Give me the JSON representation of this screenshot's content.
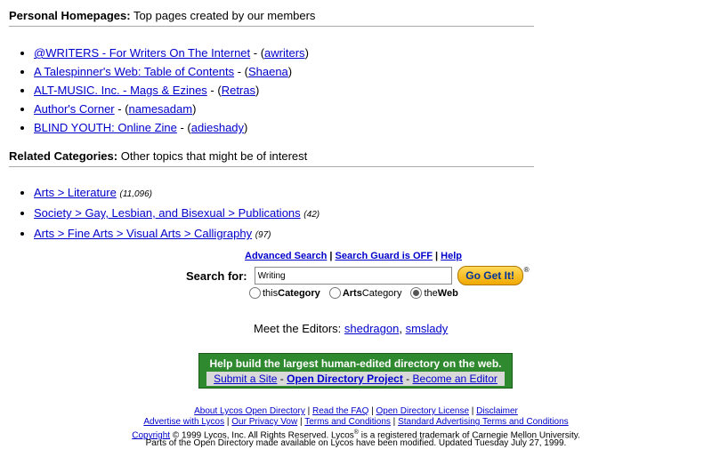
{
  "personal": {
    "heading": "Personal Homepages:",
    "subheading": "Top pages created by our members",
    "items": [
      {
        "title": "@WRITERS - For Writers On The Internet",
        "user": "awriters"
      },
      {
        "title": "A Talespinner's Web: Table of Contents",
        "user": "Shaena"
      },
      {
        "title": "ALT-MUSIC. Inc. - Mags & Ezines",
        "user": "Retras"
      },
      {
        "title": "Author's Corner",
        "user": "namesadam"
      },
      {
        "title": "BLIND YOUTH: Online Zine",
        "user": "adieshady"
      }
    ]
  },
  "related": {
    "heading": "Related Categories:",
    "subheading": "Other topics that might be of interest",
    "items": [
      {
        "path": "Arts > Literature",
        "count": "(11,096)"
      },
      {
        "path": "Society > Gay, Lesbian, and Bisexual > Publications",
        "count": "(42)"
      },
      {
        "path": "Arts > Fine Arts > Visual Arts > Calligraphy",
        "count": "(97)"
      }
    ]
  },
  "search": {
    "links": [
      "Advanced Search",
      "Search Guard is OFF",
      "Help"
    ],
    "label": "Search for:",
    "value": "Writing",
    "button": "Go Get It!",
    "reg_mark": "®",
    "options": [
      {
        "label_prefix": "this ",
        "label_bold": "Category",
        "checked": false
      },
      {
        "label_prefix": "",
        "label_bold": "Arts",
        "label_suffix": " Category",
        "checked": false
      },
      {
        "label_prefix": "the ",
        "label_bold": "Web",
        "checked": true
      }
    ]
  },
  "editors": {
    "label": "Meet the Editors:",
    "names": [
      "shedragon",
      "smslady"
    ]
  },
  "help_box": {
    "title": "Help build the largest human-edited directory on the web.",
    "links": [
      "Submit a Site",
      "Open Directory Project",
      "Become an Editor"
    ]
  },
  "footer": {
    "row1": [
      "About Lycos Open Directory",
      "Read the FAQ",
      "Open Directory License",
      "Disclaimer"
    ],
    "row2": [
      "Advertise with Lycos",
      "Our Privacy Vow",
      "Terms and Conditions",
      "Standard Advertising Terms and Conditions"
    ],
    "copyright_link": "Copyright",
    "copyright_text": "© 1999 Lycos, Inc. All Rights Reserved. Lycos",
    "copyright_text2": " is a registered trademark of Carnegie Mellon University.",
    "row4": "Parts of the Open Directory made available on Lycos have been modified. Updated Tuesday July 27, 1999."
  },
  "colors": {
    "link": "#0000cc",
    "help_green": "#2f8a2f",
    "button_gold": "#f0a800"
  }
}
